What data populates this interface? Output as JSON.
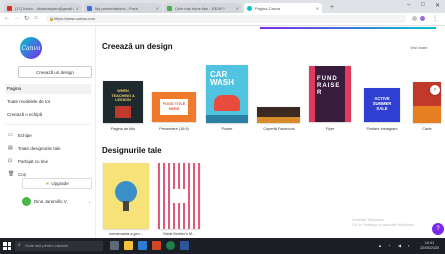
{
  "browser": {
    "tabs": [
      {
        "label": "(17) Inbox - dinomaryam@gmail.co",
        "active": false,
        "color": "#d93025"
      },
      {
        "label": "My presentations - Prezi",
        "active": false,
        "color": "#3a70e2"
      },
      {
        "label": "Cele mai bune fișe - REAP?",
        "active": false,
        "color": "#4caf50"
      },
      {
        "label": "Pagina Canva",
        "active": true,
        "color": "#00c4cc"
      }
    ],
    "new_tab": "+",
    "window_controls": {
      "minimize": "–",
      "maximize": "□",
      "close": "✕"
    },
    "url": "https://www.canva.com"
  },
  "sidebar": {
    "logo_text": "Canva",
    "create_button": "Creează un design",
    "nav": [
      {
        "label": "Pagina",
        "active": true
      },
      {
        "label": "Toate modelele de tot",
        "active": false
      },
      {
        "label": "Creează o echipă",
        "active": false
      }
    ],
    "folders": [
      {
        "label": "Echipe",
        "icon": "folder-icon"
      },
      {
        "label": "Toate designurile tale",
        "icon": "layers-icon"
      },
      {
        "label": "Partajat cu tine",
        "icon": "share-icon"
      },
      {
        "label": "Coș",
        "icon": "trash-icon"
      }
    ],
    "upgrade": "Upgrade",
    "user_name": "Dina Jaramillo V"
  },
  "main": {
    "heading_create": "Creează un design",
    "see_all": "Vezi toate",
    "templates": [
      {
        "label": "Pagina de titlu"
      },
      {
        "label": "Prezentare (16:9)"
      },
      {
        "label": "Poster"
      },
      {
        "label": "Copertă Facebook"
      },
      {
        "label": "Flyer"
      },
      {
        "label": "Postare Instagram"
      },
      {
        "label": "Carte"
      }
    ],
    "thumb_text": {
      "t1": "WHEN TEACHING A LESSON",
      "t2": "FOOD TITLE HERE",
      "t3": "CAR WASH",
      "t5": "FUND RAISE R",
      "t6": "ACTIVE SUMMER SALE"
    },
    "heading_designs": "Designurile tale",
    "designs": [
      {
        "label": "mentenanta a gen..."
      },
      {
        "label": "Great Mother's M..."
      }
    ],
    "next_arrow": "›",
    "help": "?",
    "overlay_text": [
      "Activate Windows",
      "Go to Settings to activate Windows."
    ]
  },
  "taskbar": {
    "search_placeholder": "Scrie aici pentru căutare",
    "clock_time": "10:41",
    "clock_date": "22/05/2020"
  }
}
